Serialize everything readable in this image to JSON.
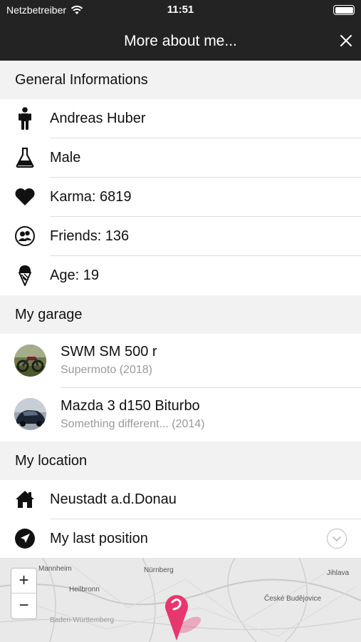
{
  "status_bar": {
    "carrier": "Netzbetreiber",
    "time": "11:51"
  },
  "navbar": {
    "title": "More about me..."
  },
  "general": {
    "header": "General Informations",
    "items": [
      {
        "icon": "person-icon",
        "label": "Andreas Huber"
      },
      {
        "icon": "flask-icon",
        "label": "Male"
      },
      {
        "icon": "heart-icon",
        "label": "Karma: 6819"
      },
      {
        "icon": "friends-icon",
        "label": "Friends: 136"
      },
      {
        "icon": "ice-cream-icon",
        "label": "Age: 19"
      }
    ]
  },
  "garage": {
    "header": "My garage",
    "items": [
      {
        "name": "SWM SM 500 r",
        "subtitle": "Supermoto (2018)"
      },
      {
        "name": "Mazda 3 d150 Biturbo",
        "subtitle": "Something different... (2014)"
      }
    ]
  },
  "location": {
    "header": "My location",
    "items": [
      {
        "icon": "home-icon",
        "label": "Neustadt a.d.Donau"
      },
      {
        "icon": "navigation-arrow-icon",
        "label": "My last position"
      }
    ]
  },
  "map": {
    "zoom_in": "+",
    "zoom_out": "−",
    "cities": [
      "Mannheim",
      "Nürnberg",
      "Jihlava",
      "Heilbronn",
      "České Budějovice",
      "Baden-Württemberg"
    ]
  },
  "colors": {
    "bar_bg": "#232323",
    "section_bg": "#f2f2f2",
    "pin": "#e8366f"
  }
}
